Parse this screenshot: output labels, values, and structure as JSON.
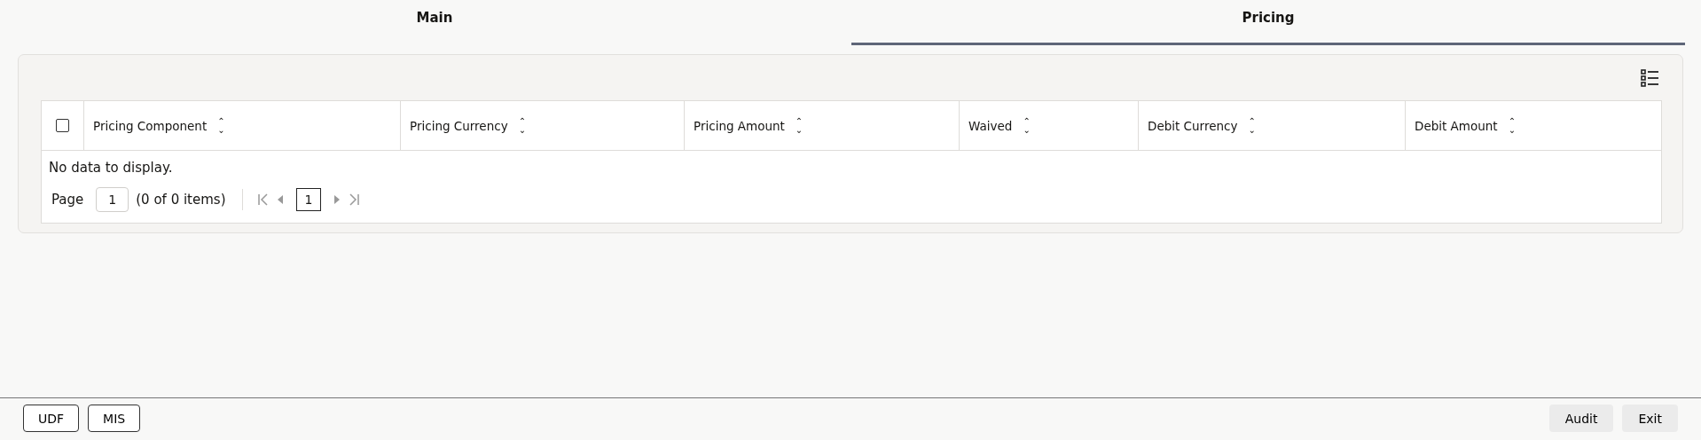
{
  "tabs": [
    {
      "label": "Main",
      "selected": false
    },
    {
      "label": "Pricing",
      "selected": true
    }
  ],
  "table": {
    "select_all": {
      "checked": false
    },
    "columns": [
      {
        "label": "Pricing Component",
        "sort_icon": "⌃⌄"
      },
      {
        "label": "Pricing Currency",
        "sort_icon": "⌃⌄"
      },
      {
        "label": "Pricing Amount",
        "sort_icon": "⌃⌄"
      },
      {
        "label": "Waived",
        "sort_icon": "⌃⌄"
      },
      {
        "label": "Debit Currency",
        "sort_icon": "⌃⌄"
      },
      {
        "label": "Debit Amount",
        "sort_icon": "⌃⌄"
      }
    ],
    "empty_message": "No data to display.",
    "pagination": {
      "label": "Page",
      "page_input": "1",
      "summary": "(0 of 0 items)",
      "current_page": "1"
    }
  },
  "footer": {
    "left_buttons": [
      "UDF",
      "MIS"
    ],
    "right_buttons": [
      "Audit",
      "Exit"
    ]
  }
}
